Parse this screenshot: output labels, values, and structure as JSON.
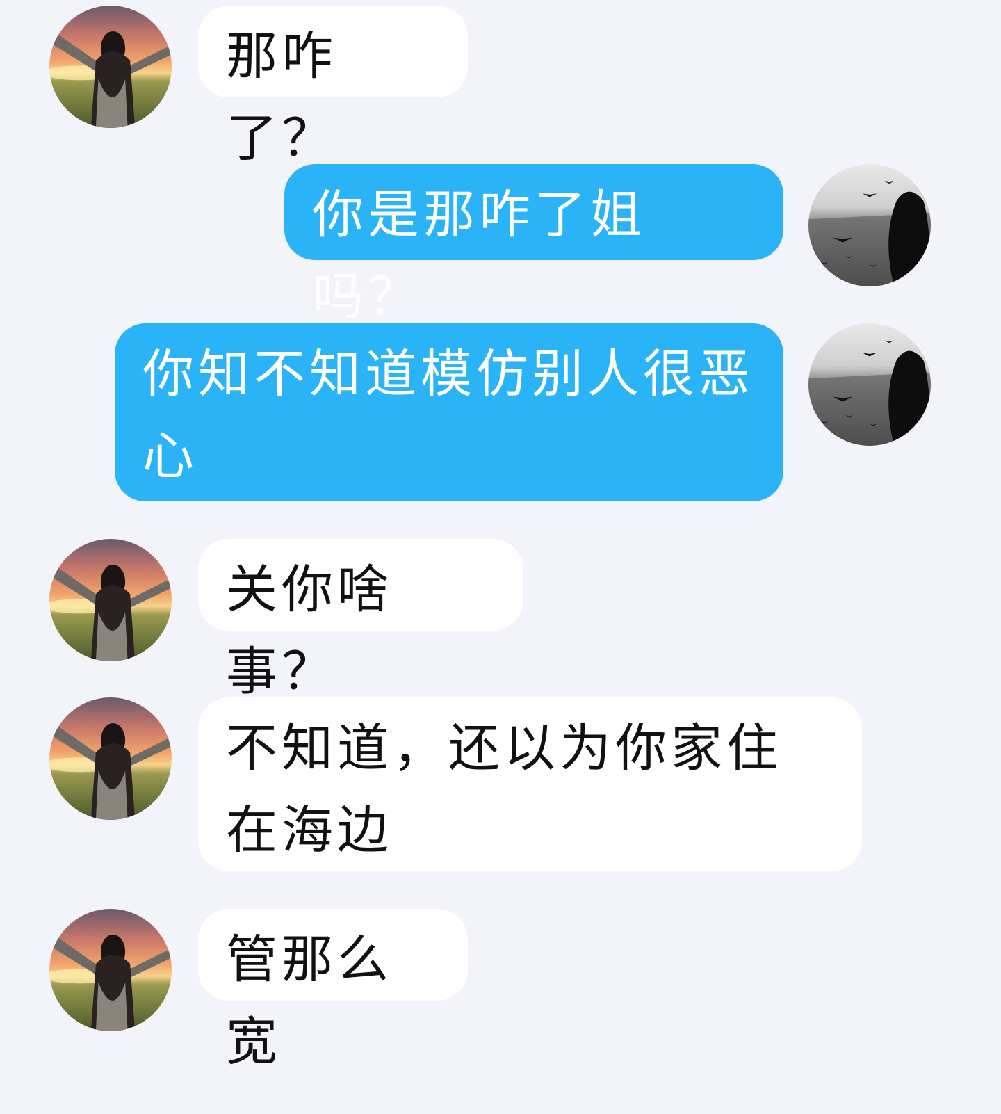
{
  "conversation": {
    "messages": [
      {
        "side": "incoming",
        "text": "那咋了？"
      },
      {
        "side": "outgoing",
        "text": "你是那咋了姐吗？"
      },
      {
        "side": "outgoing",
        "text": "你知不知道模仿别人很恶心"
      },
      {
        "side": "incoming",
        "text": "关你啥事？"
      },
      {
        "side": "incoming",
        "text": "不知道，还以为你家住在海边"
      },
      {
        "side": "incoming",
        "text": "管那么宽"
      }
    ]
  },
  "colors": {
    "background": "#f2f4f9",
    "incoming_bubble": "#ffffff",
    "outgoing_bubble": "#2bb3f7"
  },
  "icons": {
    "incoming_avatar": "avatar-sunset-girl-icon",
    "outgoing_avatar": "avatar-seagulls-girl-icon"
  }
}
